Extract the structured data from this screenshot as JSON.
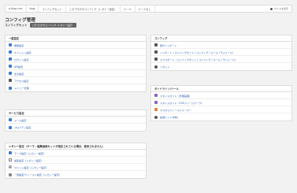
{
  "breadcrumbs": [
    "a-blog cms",
    "blog",
    "コンフィグセット",
    "このブログのコンフィグ（レガシー設定）",
    "ルール",
    "ルールなし"
  ],
  "site_link": "サイトを表示",
  "page": {
    "title": "コンフィグ管理",
    "subtitle": "コンフィグセット",
    "badge": "このブログのコンフィグ（レガシー設定）"
  },
  "general": {
    "heading": "一般設定",
    "items": [
      {
        "label": "機能設定",
        "icon": "wrench-icon"
      },
      {
        "label": "キャッシュ設定",
        "icon": "wrench-icon"
      },
      {
        "label": "ログイン設定",
        "icon": "wrench-icon"
      },
      {
        "label": "API設定",
        "icon": "wrench-icon"
      },
      {
        "label": "出力設定",
        "icon": "wrench-icon"
      },
      {
        "label": "アクセス設定",
        "icon": "lock-icon"
      },
      {
        "label": "メニュー管理",
        "icon": "wrench-icon"
      }
    ]
  },
  "service": {
    "heading": "サービス設定",
    "items": [
      {
        "label": "メール設定",
        "icon": "mail-icon"
      },
      {
        "label": "プロパティ設定",
        "icon": "wrench-icon"
      }
    ]
  },
  "legacy": {
    "heading": "レガシー設定（テーマ・編集画面セットが指定されている場合、使用されません）",
    "items": [
      {
        "label": "テーマ設定（レガシー設定）",
        "icon": "pencil-icon"
      },
      {
        "label": "編集設定（レガシー設定）",
        "icon": "table-icon"
      },
      {
        "label": "ユニット設定（レガシー設定）",
        "icon": "grid-icon"
      },
      {
        "label": "一覧設定/フィールド設定（レガシー設定）",
        "icon": "list-icon"
      }
    ]
  },
  "config": {
    "heading": "コンフィグ",
    "items": [
      {
        "label": "部分インポート",
        "icon": "import-icon"
      },
      {
        "label": "インポート（コンフィグセット / コンフィグ / ルール / モジュール）",
        "icon": "import-icon"
      },
      {
        "label": "エクスポート（コンフィグセット / コンフィグ / ルール / モジュール）",
        "icon": "export-icon"
      },
      {
        "label": "リセット",
        "icon": "reset-icon"
      }
    ]
  },
  "guide": {
    "heading": "ガイドライン/ツール",
    "items": [
      {
        "label": "スタイルガイド（管理画面）",
        "icon": "palette-icon"
      },
      {
        "label": "スタイルガイド（CSSフレームワーク）",
        "icon": "palette-icon"
      },
      {
        "label": "カスタムフィールドメーカー",
        "icon": "tool-icon"
      },
      {
        "label": "拡張ヒント(β版)",
        "icon": "hint-icon"
      }
    ]
  },
  "colors": {
    "link": "#2a5db0",
    "background": "#f2f2f2",
    "badge": "#666666"
  }
}
